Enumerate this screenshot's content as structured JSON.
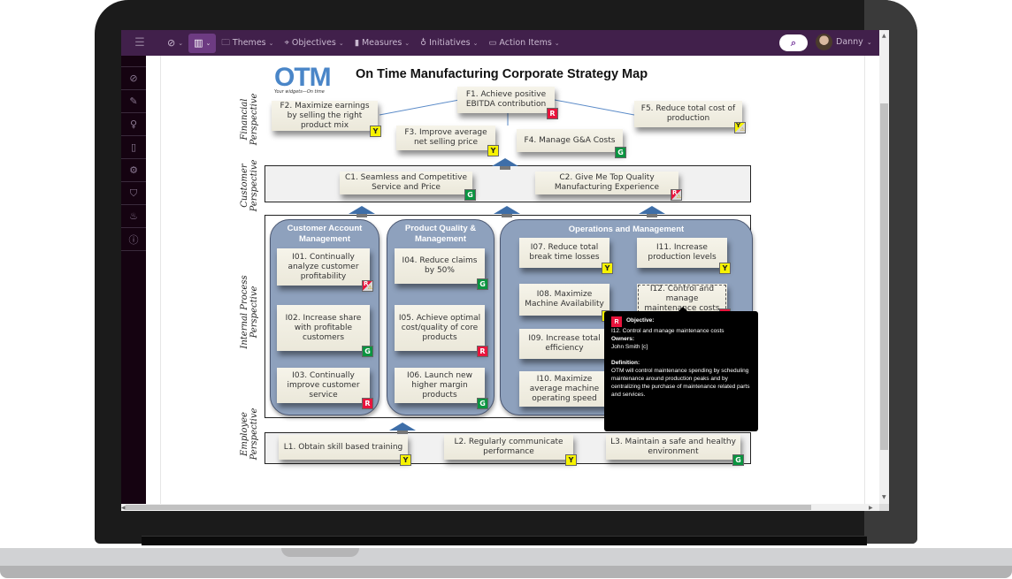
{
  "nav": {
    "menu_icon": "hamburger-icon",
    "items": [
      {
        "id": "dashboard",
        "icon": "compass-icon",
        "label": "",
        "chevron": true
      },
      {
        "id": "strategy-map",
        "icon": "map-icon",
        "label": "",
        "chevron": true,
        "active": true
      },
      {
        "id": "themes",
        "icon": "folder-icon",
        "label": "Themes",
        "chevron": true
      },
      {
        "id": "objectives",
        "icon": "crosshair-icon",
        "label": "Objectives",
        "chevron": true
      },
      {
        "id": "measures",
        "icon": "bar-chart-icon",
        "label": "Measures",
        "chevron": true
      },
      {
        "id": "initiatives",
        "icon": "lightbulb-icon",
        "label": "Initiatives",
        "chevron": true
      },
      {
        "id": "action-items",
        "icon": "inbox-icon",
        "label": "Action Items",
        "chevron": true
      }
    ],
    "search_icon": "search-icon",
    "user": {
      "name": "Danny",
      "avatar": "avatar"
    }
  },
  "sidebar": {
    "items": [
      {
        "id": "compass",
        "icon": "compass-icon",
        "glyph": "⊘"
      },
      {
        "id": "tools",
        "icon": "wrench-icon",
        "glyph": "🔧"
      },
      {
        "id": "ideas",
        "icon": "lightbulb-icon",
        "glyph": "💡"
      },
      {
        "id": "documents",
        "icon": "document-icon",
        "glyph": "🗋"
      },
      {
        "id": "settings",
        "icon": "gear-icon",
        "glyph": "⚙"
      },
      {
        "id": "security",
        "icon": "shield-icon",
        "glyph": "⛉"
      },
      {
        "id": "hot",
        "icon": "flame-icon",
        "glyph": "🔥"
      },
      {
        "id": "help",
        "icon": "help-icon",
        "glyph": "?"
      }
    ]
  },
  "map": {
    "title": "On Time Manufacturing Corporate Strategy Map",
    "logo": {
      "text": "OTM",
      "tagline": "Your widgets—On time"
    },
    "perspectives": {
      "financial": "Financial Perspective",
      "customer": "Customer Perspective",
      "internal": "Internal Process Perspective",
      "employee": "Employee Perspective"
    },
    "groups": {
      "customer_account": "Customer Account Management",
      "product_quality": "Product Quality & Management",
      "operations": "Operations and Management"
    },
    "objectives": {
      "F1": {
        "label": "F1. Achieve positive EBITDA contribution",
        "status": "R"
      },
      "F2": {
        "label": "F2. Maximize earnings by selling the right product mix",
        "status": "Y"
      },
      "F3": {
        "label": "F3. Improve average net selling price",
        "status": "Y"
      },
      "F4": {
        "label": "F4. Manage G&A Costs",
        "status": "G"
      },
      "F5": {
        "label": "F5. Reduce total cost of production",
        "status": "Y",
        "warning": true
      },
      "C1": {
        "label": "C1. Seamless and Competitive Service and Price",
        "status": "G"
      },
      "C2": {
        "label": "C2. Give Me Top Quality Manufacturing Experience",
        "status": "R",
        "warning": true
      },
      "I01": {
        "label": "I01. Continually analyze customer profitability",
        "status": "R",
        "warning": true
      },
      "I02": {
        "label": "I02. Increase share with profitable customers",
        "status": "G"
      },
      "I03": {
        "label": "I03. Continually improve customer service",
        "status": "R"
      },
      "I04": {
        "label": "I04. Reduce claims by 50%",
        "status": "G"
      },
      "I05": {
        "label": "I05. Achieve optimal cost/quality of core products",
        "status": "R"
      },
      "I06": {
        "label": "I06. Launch new higher margin products",
        "status": "G"
      },
      "I07": {
        "label": "I07. Reduce total break time losses",
        "status": "Y"
      },
      "I08": {
        "label": "I08. Maximize Machine Availability",
        "status": "Y"
      },
      "I09": {
        "label": "I09. Increase total efficiency",
        "status": ""
      },
      "I10": {
        "label": "I10. Maximize average machine operating speed",
        "status": ""
      },
      "I11": {
        "label": "I11. Increase production levels",
        "status": "Y"
      },
      "I12": {
        "label": "I12. Control and manage maintenance costs",
        "status": "R"
      },
      "L1": {
        "label": "L1. Obtain skill based training",
        "status": "Y"
      },
      "L2": {
        "label": "L2. Regularly communicate performance",
        "status": "Y"
      },
      "L3": {
        "label": "L3. Maintain a safe and healthy environment",
        "status": "G"
      }
    },
    "tooltip": {
      "status": "R",
      "objective_heading": "Objective:",
      "objective": "I12. Control and manage maintenance costs",
      "owners_heading": "Owners:",
      "owners": "John Smith [c]",
      "definition_heading": "Definition:",
      "definition": "OTM will control maintenance spending by scheduling maintenance around production peaks and by centralizing the purchase of maintenance related parts and services."
    }
  },
  "colors": {
    "nav_bg": "#41204b",
    "nav_active": "#6d3b82",
    "sidebar_bg": "#150311",
    "status_red": "#e8143c",
    "status_yellow": "#f7f300",
    "status_green": "#0a9440",
    "group_fill": "#8ea1bd"
  }
}
